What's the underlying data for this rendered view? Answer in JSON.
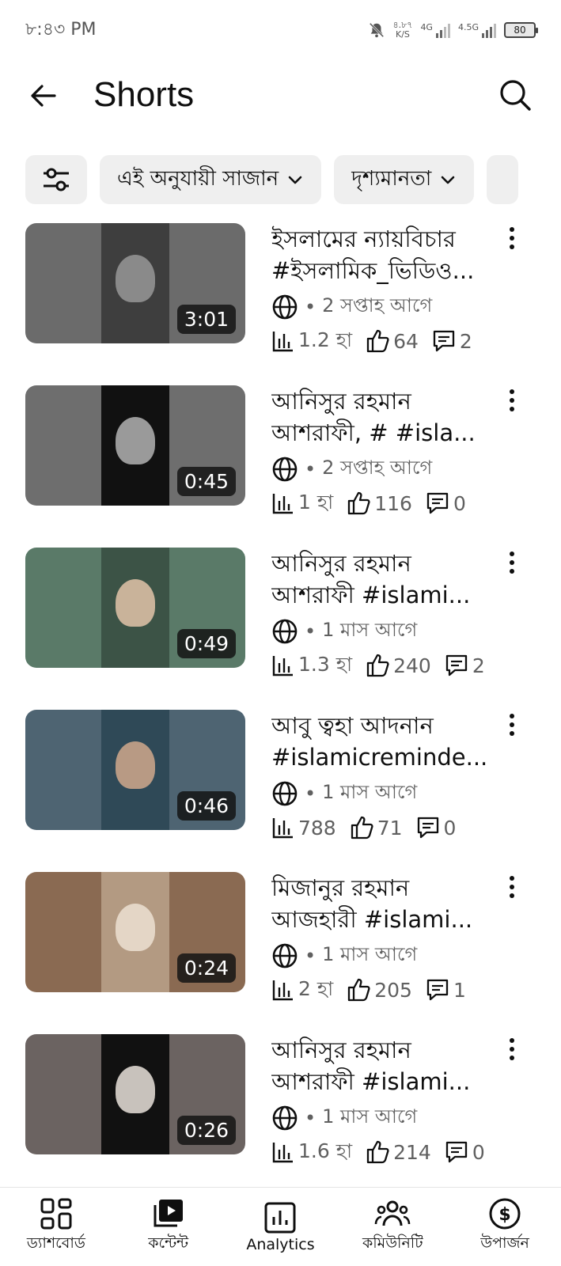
{
  "status": {
    "time": "৮:৪৩ PM",
    "speed_value": "৪.৮৭",
    "speed_unit": "K/S",
    "net1": "4G",
    "net2": "4.5G",
    "battery": "80"
  },
  "header": {
    "title": "Shorts"
  },
  "chips": [
    {
      "label": "এই অনুযায়ী সাজান"
    },
    {
      "label": "দৃশ্যমানতা"
    }
  ],
  "videos": [
    {
      "title_line1": "ইসলামের ন্যায়বিচার",
      "title_line2": "#ইসলামিক_ভিডিও...",
      "time_ago": "2 সপ্তাহ আগে",
      "views": "1.2 হা",
      "likes": "64",
      "comments": "2",
      "duration": "3:01",
      "thumb_bg": "#6b6b6b",
      "thumb_inner": "#3e3e3e",
      "thumb_face": "#8a8a8a"
    },
    {
      "title_line1": "আনিসুর রহমান",
      "title_line2": "আশরাফী, # #isla...",
      "time_ago": "2 সপ্তাহ আগে",
      "views": "1 হা",
      "likes": "116",
      "comments": "0",
      "duration": "0:45",
      "thumb_bg": "#6e6e6e",
      "thumb_inner": "#111111",
      "thumb_face": "#9a9a9a"
    },
    {
      "title_line1": "আনিসুর রহমান",
      "title_line2": "আশরাফী #islami...",
      "time_ago": "1 মাস আগে",
      "views": "1.3 হা",
      "likes": "240",
      "comments": "2",
      "duration": "0:49",
      "thumb_bg": "#5a7a68",
      "thumb_inner": "#3c5346",
      "thumb_face": "#c9b39a"
    },
    {
      "title_line1": "আবু ত্বহা আদনান",
      "title_line2": "#islamicreminde...",
      "time_ago": "1 মাস আগে",
      "views": "788",
      "likes": "71",
      "comments": "0",
      "duration": "0:46",
      "thumb_bg": "#4e6472",
      "thumb_inner": "#2f4957",
      "thumb_face": "#b89a84"
    },
    {
      "title_line1": "মিজানুর রহমান",
      "title_line2": "আজহারী #islami...",
      "time_ago": "1 মাস আগে",
      "views": "2 হা",
      "likes": "205",
      "comments": "1",
      "duration": "0:24",
      "thumb_bg": "#8a6a52",
      "thumb_inner": "#b39a82",
      "thumb_face": "#e4d6c6"
    },
    {
      "title_line1": "আনিসুর রহমান",
      "title_line2": "আশরাফী #islami...",
      "time_ago": "1 মাস আগে",
      "views": "1.6 হা",
      "likes": "214",
      "comments": "0",
      "duration": "0:26",
      "thumb_bg": "#6b6361",
      "thumb_inner": "#111111",
      "thumb_face": "#c8c2bc"
    }
  ],
  "nav": [
    {
      "label": "ড্যাশবোর্ড",
      "icon": "dashboard-icon"
    },
    {
      "label": "কন্টেন্ট",
      "icon": "content-icon"
    },
    {
      "label": "Analytics",
      "icon": "analytics-icon"
    },
    {
      "label": "কমিউনিটি",
      "icon": "community-icon"
    },
    {
      "label": "উপার্জন",
      "icon": "earn-icon"
    }
  ]
}
